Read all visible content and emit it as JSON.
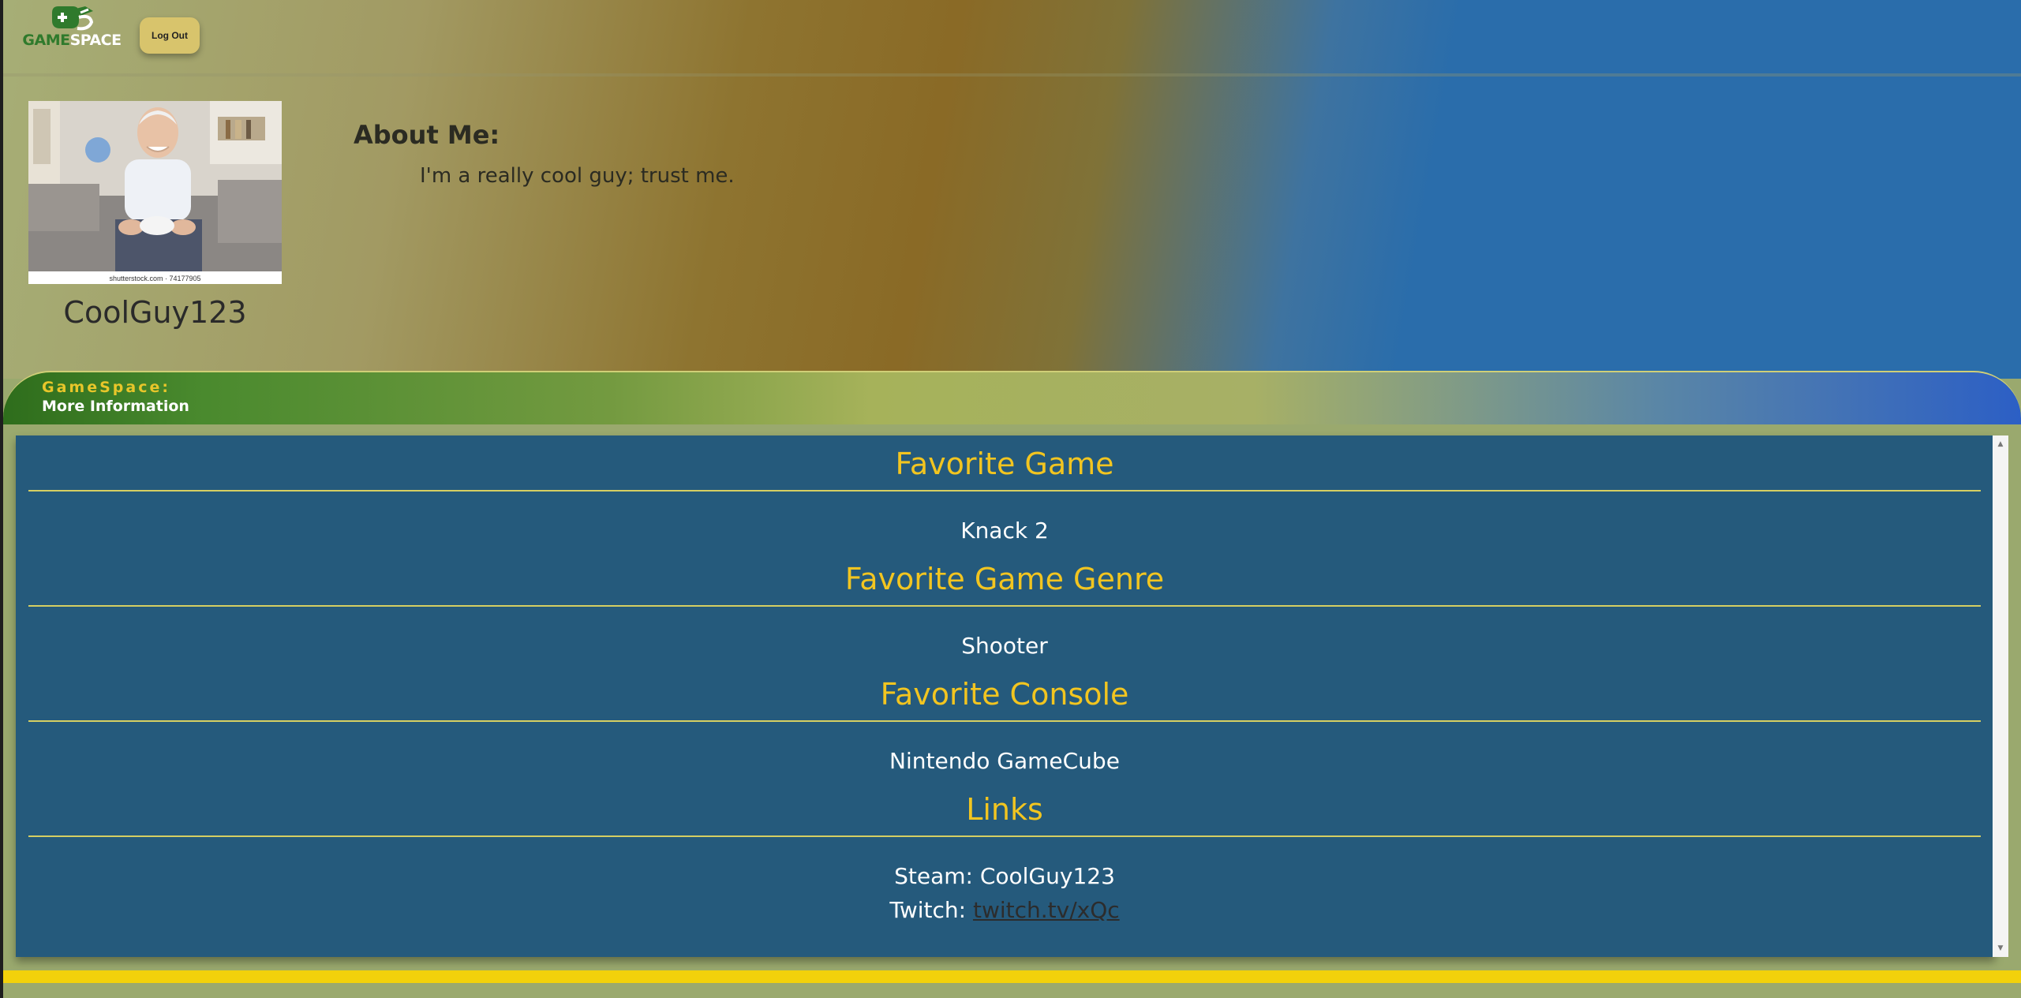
{
  "header": {
    "logo_text_game": "GAME",
    "logo_text_space": "SPACE",
    "logout_label": "Log Out"
  },
  "profile": {
    "username": "CoolGuy123",
    "photo_caption": "shutterstock.com · 74177905",
    "about_title": "About Me:",
    "about_text": "I'm a really cool guy; trust me."
  },
  "band": {
    "title": "GameSpace:",
    "subtitle": "More Information"
  },
  "info": {
    "favorite_game_title": "Favorite Game",
    "favorite_game": "Knack 2",
    "favorite_genre_title": "Favorite Game Genre",
    "favorite_genre": "Shooter",
    "favorite_console_title": "Favorite Console",
    "favorite_console": "Nintendo GameCube",
    "links_title": "Links",
    "steam_label": "Steam: ",
    "steam_value": "CoolGuy123",
    "twitch_label": "Twitch: ",
    "twitch_value": "twitch.tv/xQc"
  },
  "colors": {
    "accent_yellow": "#f2c520",
    "panel_blue": "#255a7c",
    "logo_green": "#2f7a2c",
    "button_gold": "#d8c46c"
  },
  "icons": {
    "logo": "gamepad-logo-icon",
    "scroll_up": "scroll-up-arrow-icon",
    "scroll_down": "scroll-down-arrow-icon"
  }
}
